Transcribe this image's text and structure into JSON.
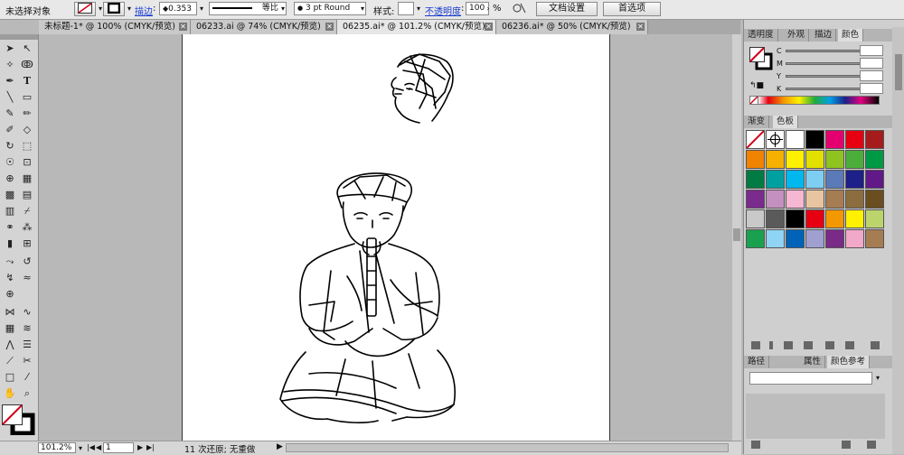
{
  "control_bar": {
    "selection_status": "未选择对象",
    "stroke_label": "描边",
    "stroke_weight": "0.353",
    "profile_label": "等比",
    "brush": "3 pt Round",
    "style_label": "样式:",
    "opacity_label": "不透明度",
    "opacity_value": "100",
    "percent": "%",
    "doc_setup": "文档设置",
    "preferences": "首选项"
  },
  "tabs": [
    {
      "label": "未标题-1* @ 100% (CMYK/预览)"
    },
    {
      "label": "06233.ai @ 74% (CMYK/预览)"
    },
    {
      "label": "06235.ai* @ 101.2% (CMYK/预览)"
    },
    {
      "label": "06236.ai* @ 50% (CMYK/预览)"
    }
  ],
  "status_bar": {
    "zoom": "101.2%",
    "page": "1",
    "history": "11 次还原; 无重做"
  },
  "color_panel": {
    "tabs": [
      "透明度",
      "外观",
      "描边",
      "颜色"
    ],
    "channels": [
      "C",
      "M",
      "Y",
      "K"
    ]
  },
  "swatches_panel": {
    "tabs": [
      "渐变",
      "色板"
    ],
    "colors": [
      "#ffffff",
      "#ffffff",
      "#ffffff",
      "#000000",
      "#e4006e",
      "#e60012",
      "#a61c1c",
      "#f08300",
      "#f5b000",
      "#fff000",
      "#e2e000",
      "#8fc31f",
      "#4cae3a",
      "#009944",
      "#007b43",
      "#00a0a0",
      "#00b7ee",
      "#7ecef4",
      "#5a7ab8",
      "#1d2088",
      "#601986",
      "#7b2a8e",
      "#c490bf",
      "#f6b7d2",
      "#e8c5a0",
      "#a67c52",
      "#8c6d3f",
      "#6b4e1f",
      "#c9c9c9",
      "#5a5a5a",
      "#000000",
      "#e60012",
      "#f39800",
      "#fff100",
      "#bbd56c",
      "#1aa14f",
      "#8fd3f5",
      "#0063b8",
      "#9fa0d0",
      "#7a2a87",
      "#f2a8c8",
      "#a67c52"
    ]
  },
  "bottom_panel": {
    "tabs": [
      "路径",
      "属性",
      "颜色参考"
    ]
  },
  "colors": {
    "accent_link": "#1a3ccf",
    "none_red": "#d0021b"
  }
}
